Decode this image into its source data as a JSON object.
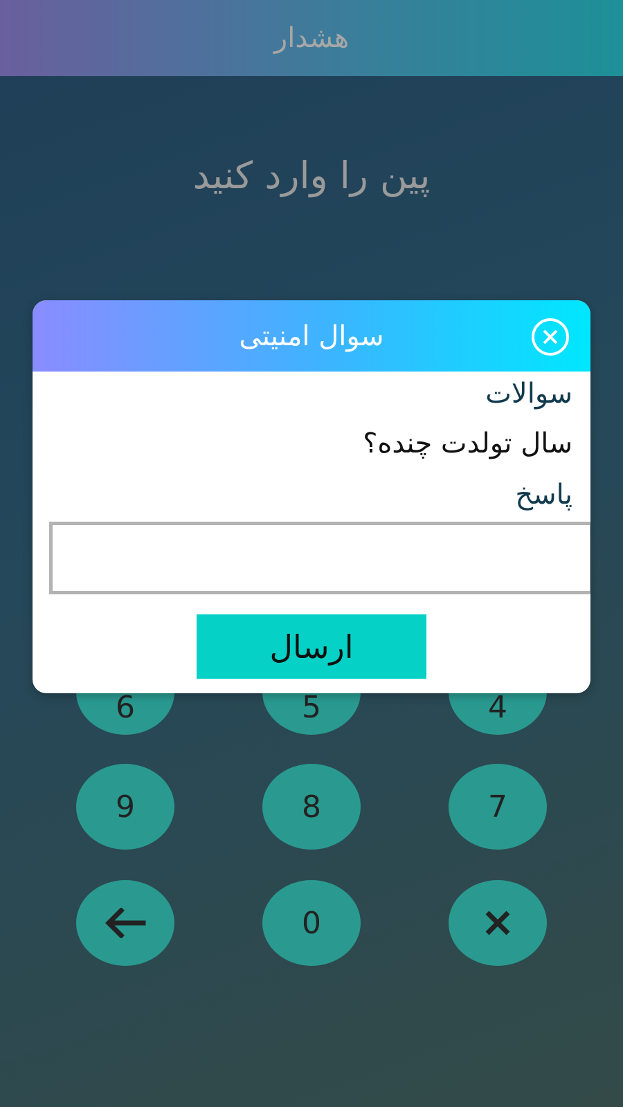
{
  "header": {
    "title": "هشدار"
  },
  "pin_screen": {
    "title": "پین را وارد کنید",
    "keypad": {
      "row1": [
        "6",
        "5",
        "4"
      ],
      "row2": [
        "9",
        "8",
        "7"
      ],
      "zero": "0",
      "back_icon": "arrow-left-icon",
      "clear_icon": "close-x-icon"
    }
  },
  "modal": {
    "title": "سوال امنیتی",
    "close_icon": "close-circle-icon",
    "questions_label": "سوالات",
    "question": "سال تولدت چنده؟",
    "answer_label": "پاسخ",
    "answer_value": "",
    "submit_label": "ارسال"
  },
  "colors": {
    "header_gradient_start": "#6a5f9e",
    "header_gradient_end": "#1d9098",
    "modal_header_start": "#8a8cff",
    "modal_header_end": "#00e7ff",
    "key_fill": "#2a9a90",
    "submit_fill": "#06d1c6"
  }
}
